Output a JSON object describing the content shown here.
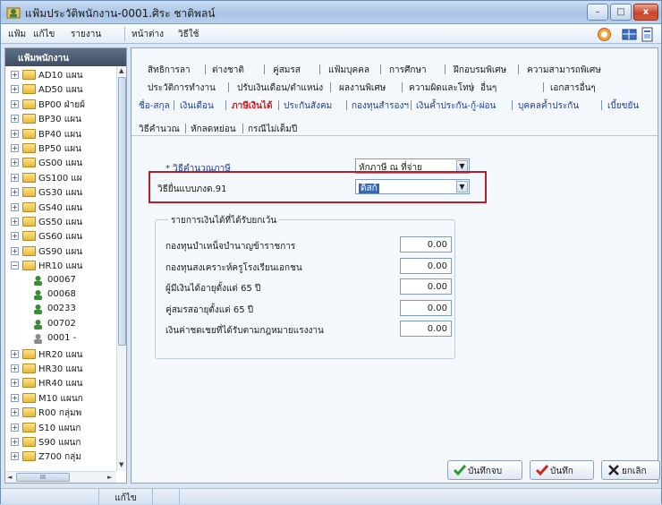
{
  "window": {
    "title": "แฟ้มประวัติพนักงาน-0001.ศิระ ชาติพลน์",
    "minimize_label": "–",
    "maximize_label": "□",
    "close_label": "x"
  },
  "menubar": {
    "items": [
      "แฟ้ม",
      "แก้ไข",
      "รายงาน",
      "หน้าต่าง",
      "วิธีใช้"
    ]
  },
  "left_panel": {
    "header": "แฟ้มพนักงาน",
    "tree": [
      {
        "expander": "+",
        "label": "AD10 แผน",
        "type": "folder"
      },
      {
        "expander": "+",
        "label": "AD50 แผน",
        "type": "folder"
      },
      {
        "expander": "+",
        "label": "BP00 ฝ่ายผ้",
        "type": "folder"
      },
      {
        "expander": "+",
        "label": "BP30 แผน",
        "type": "folder"
      },
      {
        "expander": "+",
        "label": "BP40 แผน",
        "type": "folder"
      },
      {
        "expander": "+",
        "label": "BP50 แผน",
        "type": "folder"
      },
      {
        "expander": "+",
        "label": "GS00 แผน",
        "type": "folder"
      },
      {
        "expander": "+",
        "label": "GS100 แผ",
        "type": "folder"
      },
      {
        "expander": "+",
        "label": "GS30 แผน",
        "type": "folder"
      },
      {
        "expander": "+",
        "label": "GS40 แผน",
        "type": "folder"
      },
      {
        "expander": "+",
        "label": "GS50 แผน",
        "type": "folder"
      },
      {
        "expander": "+",
        "label": "GS60 แผน",
        "type": "folder"
      },
      {
        "expander": "+",
        "label": "GS90 แผน",
        "type": "folder"
      },
      {
        "expander": "−",
        "label": "HR10 แผน",
        "type": "folder"
      },
      {
        "expander": "",
        "label": "00067",
        "type": "employee"
      },
      {
        "expander": "",
        "label": "00068",
        "type": "employee"
      },
      {
        "expander": "",
        "label": "00233",
        "type": "employee"
      },
      {
        "expander": "",
        "label": "00702",
        "type": "employee"
      },
      {
        "expander": "",
        "label": "0001 -",
        "type": "employee-selected"
      },
      {
        "expander": "+",
        "label": "HR20 แผน",
        "type": "folder"
      },
      {
        "expander": "+",
        "label": "HR30 แผน",
        "type": "folder"
      },
      {
        "expander": "+",
        "label": "HR40 แผน",
        "type": "folder"
      },
      {
        "expander": "+",
        "label": "M10 แผนก",
        "type": "folder"
      },
      {
        "expander": "+",
        "label": "R00 กลุ่มพ",
        "type": "folder"
      },
      {
        "expander": "+",
        "label": "S10 แผนก",
        "type": "folder"
      },
      {
        "expander": "+",
        "label": "S90 แผนก",
        "type": "folder"
      },
      {
        "expander": "+",
        "label": "Z700 กลุ่ม",
        "type": "folder"
      }
    ],
    "hscroll_label": "III"
  },
  "tabs": {
    "row1": [
      "สิทธิการลา",
      "ต่างชาติ",
      "คู่สมรส",
      "แฟ้มบุคคล",
      "การศึกษา",
      "ฝึกอบรมพิเศษ",
      "ความสามารถพิเศษ"
    ],
    "row2": [
      "ประวัติการทำงาน",
      "ปรับเงินเดือน/ตำแหน่ง",
      "ผลงานพิเศษ",
      "ความผิดและโทษ",
      "อื่นๆ",
      "เอกสารอื่นๆ"
    ],
    "row3": [
      "ชื่อ-สกุล",
      "เงินเดือน",
      "ภาษีเงินได้",
      "ประกันสังคม",
      "กองทุนสำรองฯ",
      "เงินค้ำประกัน-กู้-ผ่อน",
      "บุคคลค้ำประกัน",
      "เบี้ยขยัน"
    ],
    "active": "ภาษีเงินได้"
  },
  "subtabs": [
    "วิธีคำนวณ",
    "หักลดหย่อน",
    "กรณีไม่เต็มปี"
  ],
  "form": {
    "tax_method_label": "* วิธีคำนวณภาษี",
    "tax_method_value": "หักภาษี ณ ที่จ่าย",
    "pnd91_label": "วิธียื่นแบบภงด.91",
    "pnd91_value": "ดิสก์",
    "exempt_group_title": "รายการเงินได้ที่ได้รับยกเว้น",
    "exempt_items": [
      {
        "label": "กองทุนบำเหน็จบำนาญข้าราชการ",
        "value": "0.00"
      },
      {
        "label": "กองทุนสงเคราะห์ครูโรงเรียนเอกชน",
        "value": "0.00"
      },
      {
        "label": "ผู้มีเงินได้อายุตั้งแต่ 65 ปี",
        "value": "0.00"
      },
      {
        "label": "คู่สมรสอายุตั้งแต่ 65 ปี",
        "value": "0.00"
      },
      {
        "label": "เงินค่าชดเชยที่ได้รับตามกฎหมายแรงงาน",
        "value": "0.00"
      }
    ]
  },
  "buttons": {
    "save_close": "บันทึกจบ",
    "save": "บันทึก",
    "cancel": "ยกเลิก"
  },
  "statusbar": {
    "mode": "แก้ไข"
  },
  "colors": {
    "active_tab": "#cc1a1a",
    "link_tab": "#1b3fa0",
    "highlight_box": "#b31d2c",
    "selection": "#3169c6"
  }
}
